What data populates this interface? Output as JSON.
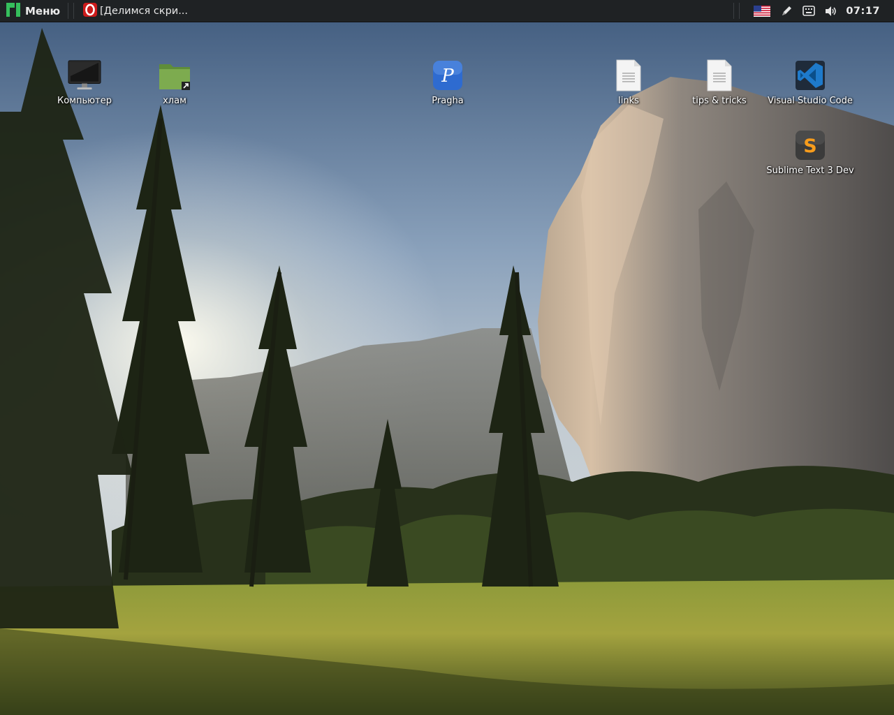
{
  "panel": {
    "menu_label": "Меню",
    "task_title": "[Делимся скри...",
    "clock": "07:17",
    "tray_icons": [
      "us-flag-icon",
      "pen-icon",
      "keyboard-icon",
      "volume-icon"
    ]
  },
  "desktop": {
    "icons": [
      {
        "name": "computer-icon",
        "label": "Компьютер"
      },
      {
        "name": "folder-link-icon",
        "label": "хлам"
      },
      {
        "name": "pragha-icon",
        "label": "Pragha"
      },
      {
        "name": "text-file-icon",
        "label": "links"
      },
      {
        "name": "text-file-icon",
        "label": "tips & tricks"
      },
      {
        "name": "vscode-icon",
        "label": "Visual Studio Code"
      },
      {
        "name": "sublime-icon",
        "label": "Sublime Text 3 Dev"
      }
    ]
  },
  "colors": {
    "panel_bg": "#1f2224",
    "menu_logo": "#35bf5c",
    "opera_red": "#cc1b1b",
    "folder_green": "#7dab4f",
    "pragha_blue": "#2e6bd0",
    "vscode_blue": "#1e7acb",
    "sublime_orange": "#f79c1c"
  }
}
